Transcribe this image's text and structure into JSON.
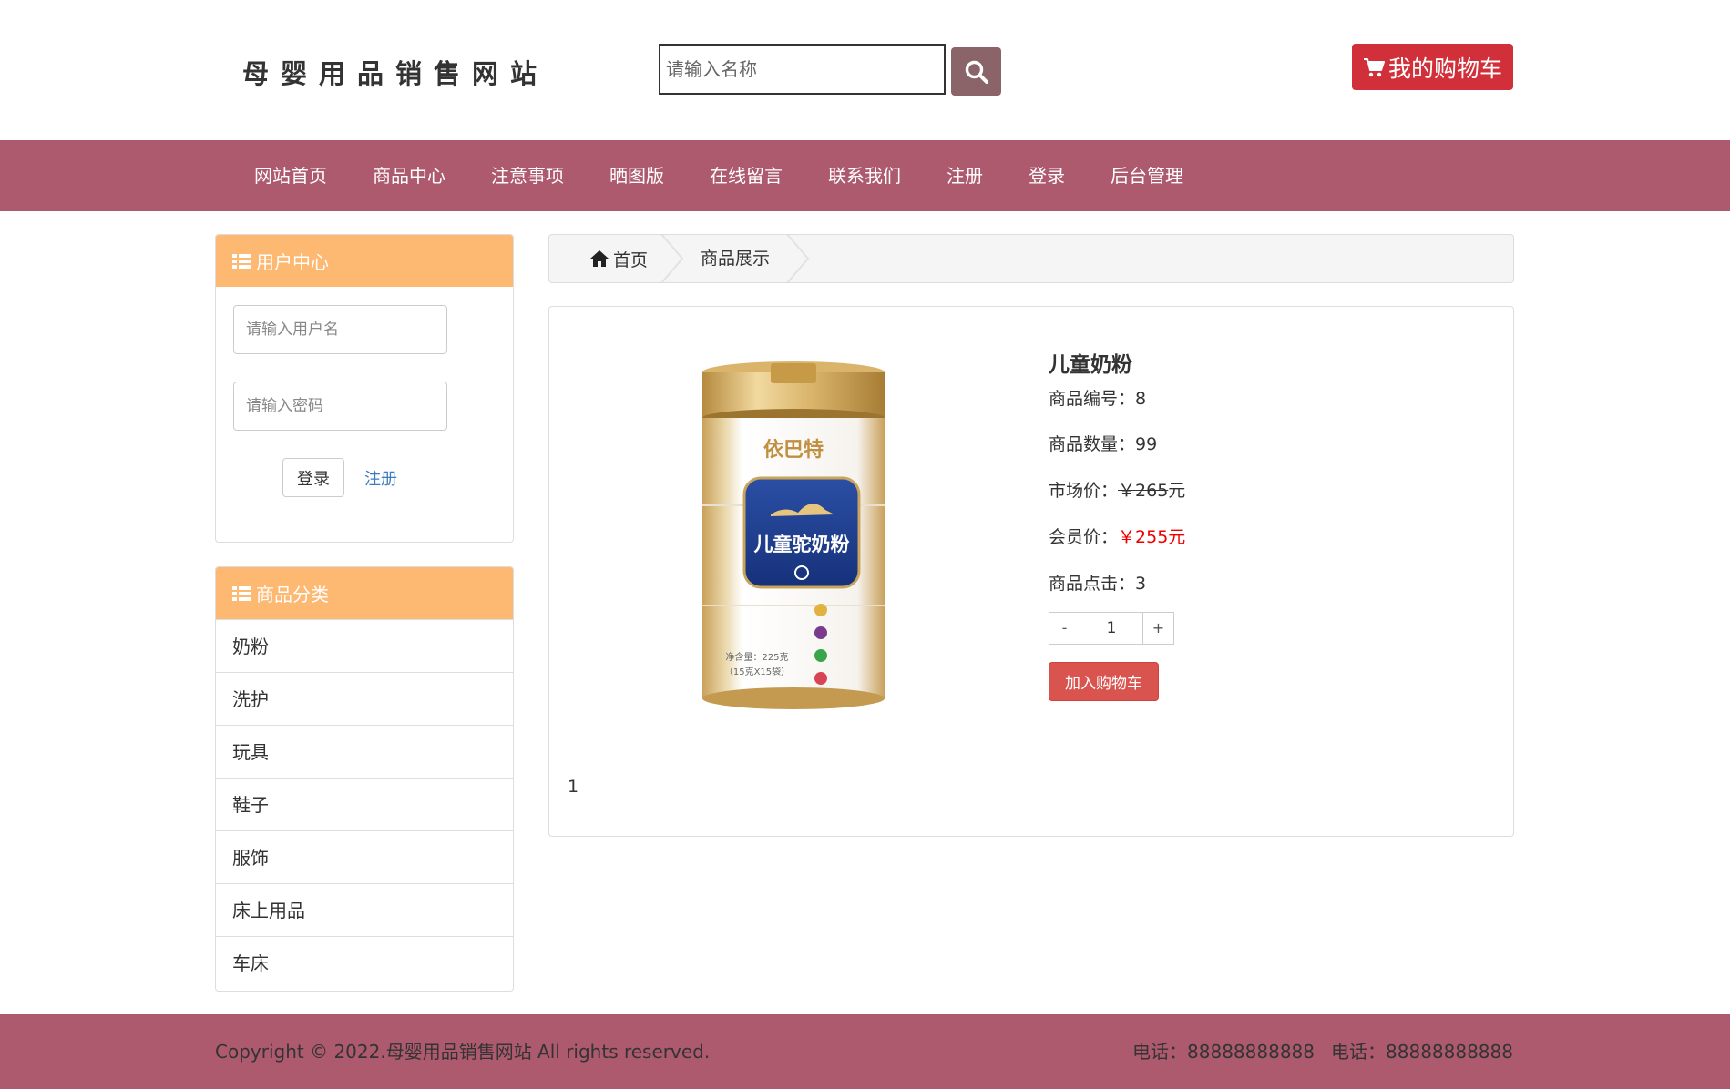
{
  "header": {
    "site_title": "母婴用品销售网站",
    "search_placeholder": "请输入名称",
    "cart_label": "我的购物车"
  },
  "nav": {
    "items": [
      "网站首页",
      "商品中心",
      "注意事项",
      "晒图版",
      "在线留言",
      "联系我们",
      "注册",
      "登录",
      "后台管理"
    ]
  },
  "user_center": {
    "title": "用户中心",
    "username_placeholder": "请输入用户名",
    "password_placeholder": "请输入密码",
    "login_label": "登录",
    "register_label": "注册"
  },
  "categories": {
    "title": "商品分类",
    "items": [
      "奶粉",
      "洗护",
      "玩具",
      "鞋子",
      "服饰",
      "床上用品",
      "车床"
    ]
  },
  "breadcrumb": {
    "home": "首页",
    "current": "商品展示"
  },
  "product": {
    "name": "儿童奶粉",
    "id_label": "商品编号：",
    "id": "8",
    "stock_label": "商品数量：",
    "stock": "99",
    "market_price_label": "市场价：",
    "market_price": "￥265",
    "market_price_unit": "元",
    "member_price_label": "会员价：",
    "member_price": "￥255元",
    "clicks_label": "商品点击：",
    "clicks": "3",
    "qty_minus": "-",
    "qty_value": "1",
    "qty_plus": "+",
    "add_cart_label": "加入购物车",
    "image_brand": "依巴特",
    "image_product": "儿童驼奶粉",
    "image_net": "净含量：225克",
    "image_net2": "（15克X15袋）"
  },
  "pagination": {
    "current_page": "1"
  },
  "footer": {
    "copyright": "Copyright © 2022.母婴用品销售网站 All rights reserved.",
    "phone1": "电话：88888888888",
    "phone2": "电话：88888888888"
  },
  "colors": {
    "nav_bg": "#ad5a6f",
    "panel_head": "#fdb872",
    "cart_red": "#d1303a",
    "search_btn": "#8a6468",
    "member_price": "#e00000"
  }
}
